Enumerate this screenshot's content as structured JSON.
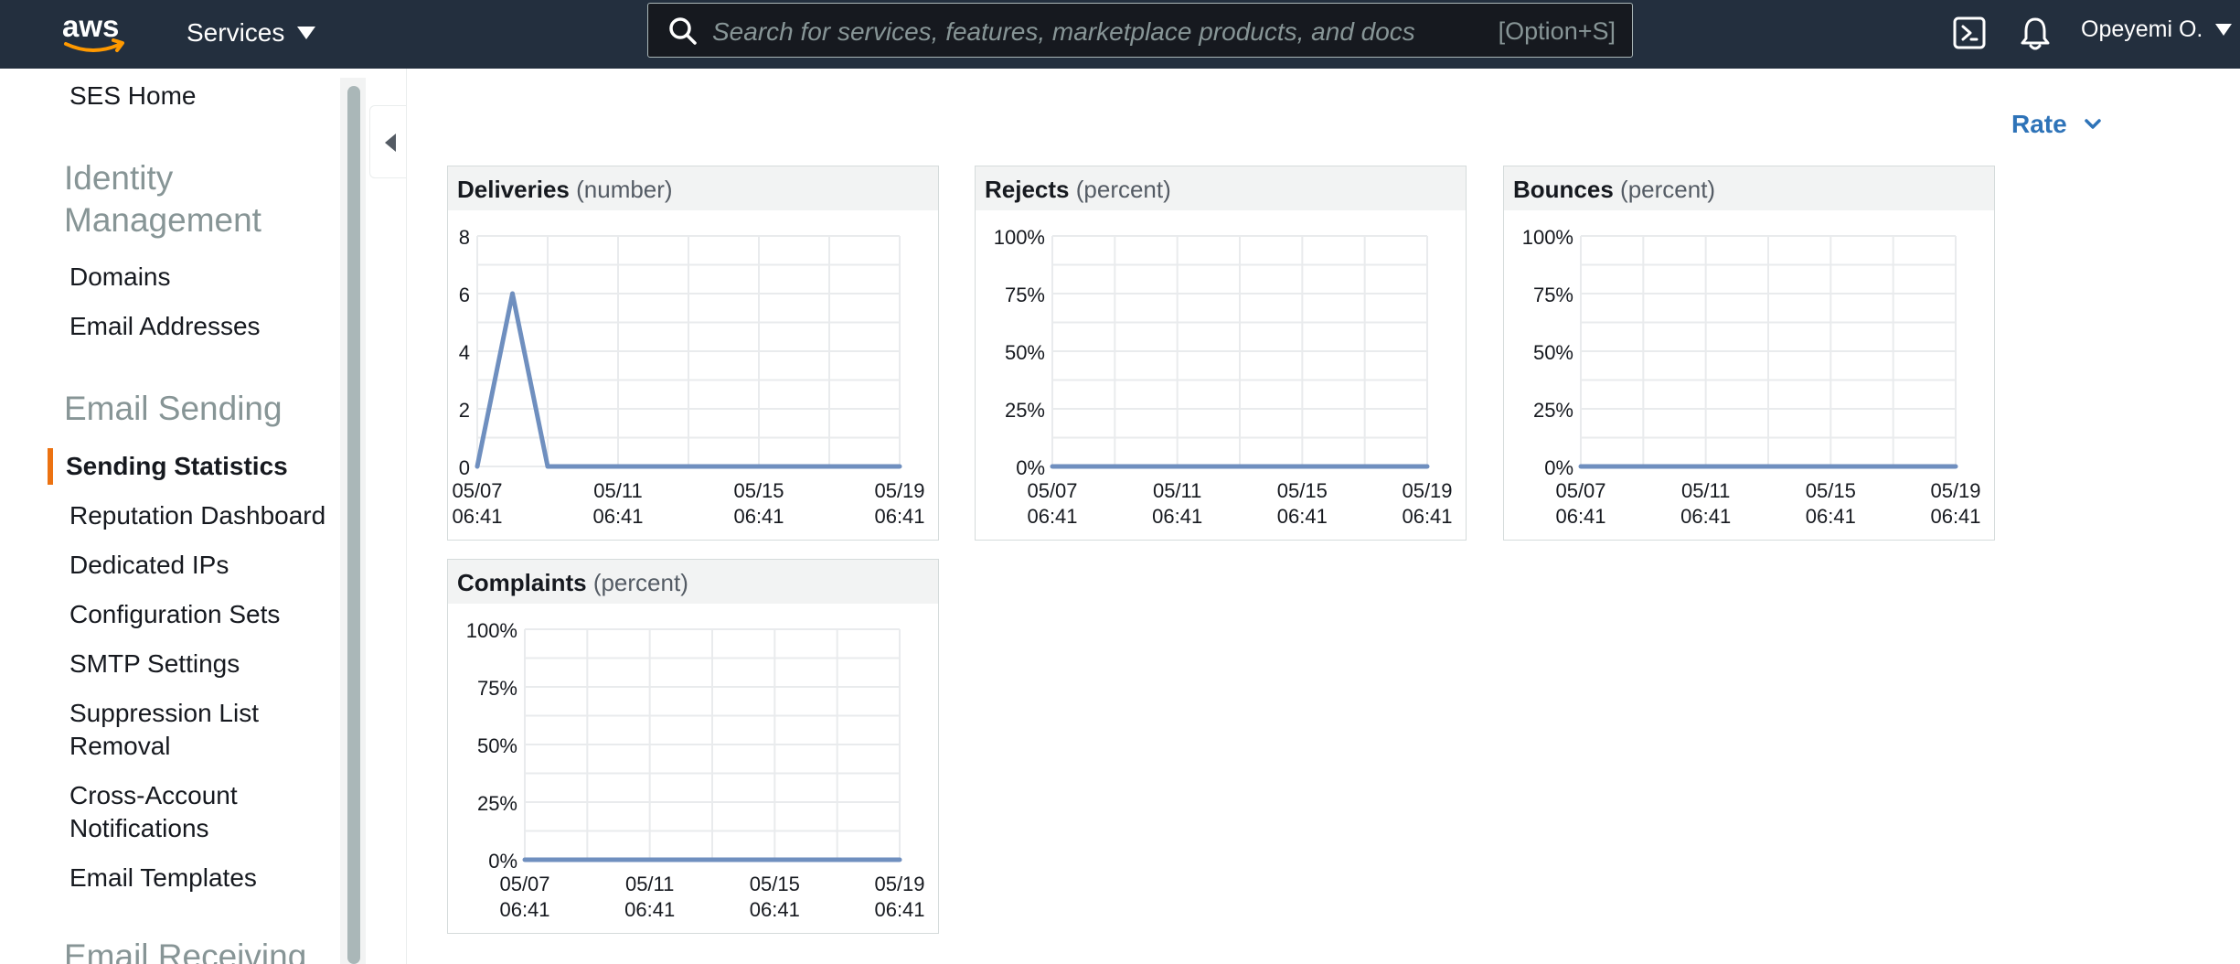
{
  "topnav": {
    "logo_text": "aws",
    "services_label": "Services",
    "search_placeholder": "Search for services, features, marketplace products, and docs",
    "search_shortcut": "[Option+S]",
    "user_label": "Opeyemi O.",
    "icons": [
      "cloudshell-icon",
      "bell-icon"
    ]
  },
  "sidebar": {
    "home": "SES Home",
    "sections": [
      {
        "heading": "Identity\nManagement",
        "items": [
          "Domains",
          "Email Addresses"
        ]
      },
      {
        "heading": "Email Sending",
        "items": [
          "Sending Statistics",
          "Reputation Dashboard",
          "Dedicated IPs",
          "Configuration Sets",
          "SMTP Settings",
          "Suppression List Removal",
          "Cross-Account Notifications",
          "Email Templates"
        ]
      },
      {
        "heading": "Email Receiving",
        "items": []
      }
    ],
    "active_item": "Sending Statistics"
  },
  "main": {
    "rate_label": "Rate"
  },
  "colors": {
    "accent_orange": "#ec7211",
    "link_blue": "#2e73b8",
    "series_line": "#6f8fbf",
    "nav_bg": "#232f3e"
  },
  "chart_data": [
    {
      "type": "line",
      "title": "Deliveries",
      "unit": "(number)",
      "x": [
        "05/07 06:41",
        "05/08 06:41",
        "05/09 06:41",
        "05/10 06:41",
        "05/11 06:41",
        "05/12 06:41",
        "05/13 06:41",
        "05/14 06:41",
        "05/15 06:41",
        "05/16 06:41",
        "05/17 06:41",
        "05/18 06:41",
        "05/19 06:41"
      ],
      "x_tick_labels": [
        [
          "05/07",
          "06:41"
        ],
        [
          "05/11",
          "06:41"
        ],
        [
          "05/15",
          "06:41"
        ],
        [
          "05/19",
          "06:41"
        ]
      ],
      "series": [
        {
          "values": [
            0,
            6,
            0,
            0,
            0,
            0,
            0,
            0,
            0,
            0,
            0,
            0,
            0
          ]
        }
      ],
      "y_ticks": [
        "8",
        "6",
        "4",
        "2",
        "0"
      ],
      "ylim": [
        0,
        8
      ],
      "grid": true
    },
    {
      "type": "line",
      "title": "Rejects",
      "unit": "(percent)",
      "x": [
        "05/07 06:41",
        "05/19 06:41"
      ],
      "x_tick_labels": [
        [
          "05/07",
          "06:41"
        ],
        [
          "05/11",
          "06:41"
        ],
        [
          "05/15",
          "06:41"
        ],
        [
          "05/19",
          "06:41"
        ]
      ],
      "series": [
        {
          "values": [
            0,
            0
          ]
        }
      ],
      "y_ticks": [
        "100%",
        "75%",
        "50%",
        "25%",
        "0%"
      ],
      "ylim": [
        0,
        100
      ],
      "grid": true
    },
    {
      "type": "line",
      "title": "Bounces",
      "unit": "(percent)",
      "x": [
        "05/07 06:41",
        "05/19 06:41"
      ],
      "x_tick_labels": [
        [
          "05/07",
          "06:41"
        ],
        [
          "05/11",
          "06:41"
        ],
        [
          "05/15",
          "06:41"
        ],
        [
          "05/19",
          "06:41"
        ]
      ],
      "series": [
        {
          "values": [
            0,
            0
          ]
        }
      ],
      "y_ticks": [
        "100%",
        "75%",
        "50%",
        "25%",
        "0%"
      ],
      "ylim": [
        0,
        100
      ],
      "grid": true
    },
    {
      "type": "line",
      "title": "Complaints",
      "unit": "(percent)",
      "x": [
        "05/07 06:41",
        "05/19 06:41"
      ],
      "x_tick_labels": [
        [
          "05/07",
          "06:41"
        ],
        [
          "05/11",
          "06:41"
        ],
        [
          "05/15",
          "06:41"
        ],
        [
          "05/19",
          "06:41"
        ]
      ],
      "series": [
        {
          "values": [
            0,
            0
          ]
        }
      ],
      "y_ticks": [
        "100%",
        "75%",
        "50%",
        "25%",
        "0%"
      ],
      "ylim": [
        0,
        100
      ],
      "grid": true
    }
  ]
}
